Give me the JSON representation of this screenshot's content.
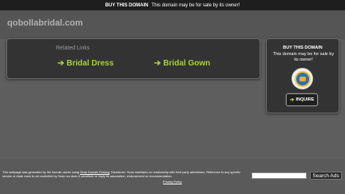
{
  "top_bar": {
    "buy_link": "BUY THIS DOMAIN",
    "message": "This domain may be for sale by its owner!"
  },
  "header": {
    "domain": "qobollabridal.com"
  },
  "related_links": {
    "heading": "Related Links",
    "links": [
      {
        "label": "Bridal Dress"
      },
      {
        "label": "Bridal Gown"
      }
    ]
  },
  "sale_box": {
    "title": "BUY THIS DOMAIN",
    "text": "This domain may be for sale by its owner!",
    "button_label": "INQUIRE"
  },
  "footer": {
    "disclaimer_part1": "This webpage was generated by the domain owner using ",
    "disclaimer_link": "Sedo Domain Parking",
    "disclaimer_part2": ". Disclaimer: Sedo maintains no relationship with third party advertisers. Reference to any specific service or trade mark is not controlled by Sedo nor does it constitute or imply its association, endorsement or recommendation.",
    "privacy_label": "Privacy Policy",
    "search_placeholder": "",
    "search_button": "Search Ads"
  },
  "colors": {
    "link_green": "#a6d23a",
    "background": "#5a5a5a",
    "box": "#333333"
  },
  "icons": {
    "arrow": "right-arrow-icon",
    "seal": "domain-seal-icon"
  }
}
